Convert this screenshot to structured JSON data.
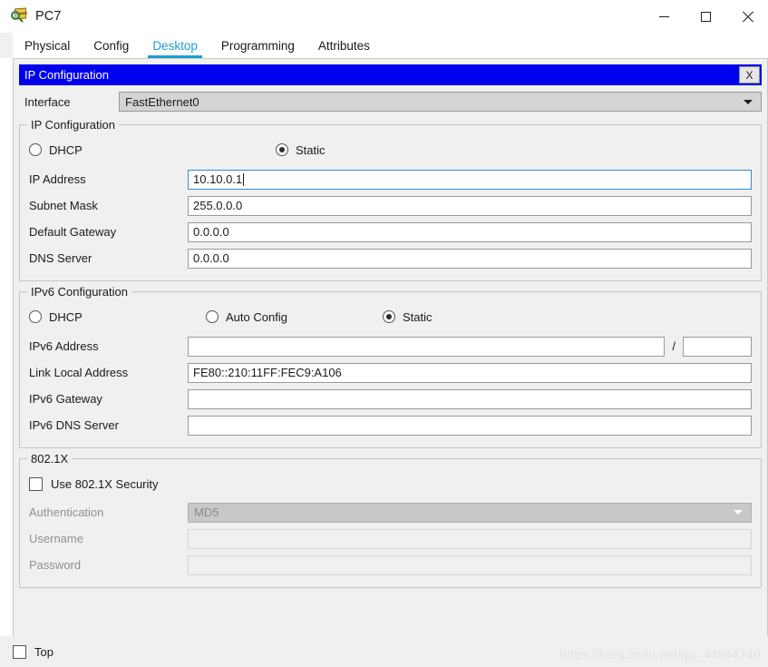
{
  "window": {
    "title": "PC7",
    "icon": "packet-tracer-device-icon",
    "controls": {
      "minimize": "minimize-icon",
      "maximize": "maximize-icon",
      "close": "close-icon"
    }
  },
  "tabs": [
    {
      "label": "Physical",
      "active": false
    },
    {
      "label": "Config",
      "active": false
    },
    {
      "label": "Desktop",
      "active": true
    },
    {
      "label": "Programming",
      "active": false
    },
    {
      "label": "Attributes",
      "active": false
    }
  ],
  "dialog": {
    "title": "IP Configuration",
    "close_label": "X"
  },
  "interface": {
    "label": "Interface",
    "value": "FastEthernet0"
  },
  "ipv4": {
    "group_title": "IP Configuration",
    "dhcp_label": "DHCP",
    "static_label": "Static",
    "mode": "Static",
    "fields": {
      "ip_address_label": "IP Address",
      "ip_address_value": "10.10.0.1",
      "subnet_mask_label": "Subnet Mask",
      "subnet_mask_value": "255.0.0.0",
      "default_gateway_label": "Default Gateway",
      "default_gateway_value": "0.0.0.0",
      "dns_server_label": "DNS Server",
      "dns_server_value": "0.0.0.0"
    }
  },
  "ipv6": {
    "group_title": "IPv6 Configuration",
    "dhcp_label": "DHCP",
    "auto_config_label": "Auto Config",
    "static_label": "Static",
    "mode": "Static",
    "fields": {
      "ipv6_address_label": "IPv6 Address",
      "ipv6_address_value": "",
      "prefix_value": "",
      "prefix_separator": "/",
      "link_local_label": "Link Local Address",
      "link_local_value": "FE80::210:11FF:FEC9:A106",
      "ipv6_gateway_label": "IPv6 Gateway",
      "ipv6_gateway_value": "",
      "ipv6_dns_label": "IPv6 DNS Server",
      "ipv6_dns_value": ""
    }
  },
  "dot1x": {
    "group_title": "802.1X",
    "use_security_label": "Use 802.1X Security",
    "use_security_checked": false,
    "authentication_label": "Authentication",
    "authentication_value": "MD5",
    "username_label": "Username",
    "username_value": "",
    "password_label": "Password",
    "password_value": ""
  },
  "footer": {
    "top_label": "Top",
    "top_checked": false,
    "watermark": "https://blog.csdn.net/qq_44644740"
  },
  "colors": {
    "accent_tab": "#1a9fd4",
    "dialog_header": "#0000ee",
    "focus_border": "#2a8fd8",
    "panel_bg": "#f0f0f0"
  }
}
